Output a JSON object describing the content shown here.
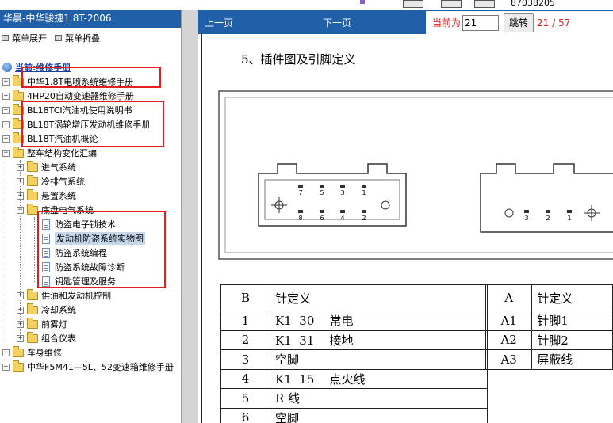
{
  "top_strip": {
    "phone_fragment": "87038205"
  },
  "left_panel": {
    "title": "华晨-中华骏捷1.8T-2006",
    "menu_expand": "菜单展开",
    "menu_collapse": "菜单折叠",
    "root_label": "当前:维修手册",
    "tree": [
      {
        "label": "中华1.8T电喷系统维修手册",
        "pm": "+"
      },
      {
        "label": "4HP20自动变速器维修手册",
        "pm": "+"
      },
      {
        "label": "BL18TCI汽油机使用说明书",
        "pm": "+"
      },
      {
        "label": "BL18T涡轮增压发动机维修手册",
        "pm": "+"
      },
      {
        "label": "BL18T汽油机概论",
        "pm": "+"
      },
      {
        "label": "整车结构变化汇编",
        "pm": "−",
        "children": [
          {
            "label": "进气系统",
            "pm": "+"
          },
          {
            "label": "冷排气系统",
            "pm": "+"
          },
          {
            "label": "悬置系统",
            "pm": "+"
          },
          {
            "label": "底盘电气系统",
            "pm": "−",
            "children": [
              {
                "label": "防盗电子锁技术"
              },
              {
                "label": "发动机防盗系统实物图"
              },
              {
                "label": "防盗系统编程"
              },
              {
                "label": "防盗系统故障诊断"
              },
              {
                "label": "钥匙管理及服务"
              }
            ]
          },
          {
            "label": "供油和发动机控制",
            "pm": "+"
          },
          {
            "label": "冷却系统",
            "pm": "+"
          },
          {
            "label": "前雾灯",
            "pm": "+"
          },
          {
            "label": "组合仪表",
            "pm": "+"
          }
        ]
      },
      {
        "label": "车身维修",
        "pm": "+"
      },
      {
        "label": "中华F5M41—5L、52变速箱维修手册",
        "pm": "+"
      }
    ]
  },
  "viewer": {
    "prev_label": "上一页",
    "next_label": "下一页",
    "current_label": "当前为",
    "current_page": "21",
    "jump_label": "跳转",
    "page_count": "21 / 57"
  },
  "document": {
    "heading": "5、插件图及引脚定义",
    "connector_b_pins": [
      "7",
      "5",
      "3",
      "1",
      "8",
      "6",
      "4",
      "2"
    ],
    "connector_a_pins": [
      "3",
      "2",
      "1"
    ],
    "table_b": {
      "header": [
        "B",
        "针定义"
      ],
      "rows": [
        [
          "1",
          "K1  30    常电"
        ],
        [
          "2",
          "K1  31    接地"
        ],
        [
          "3",
          "空脚"
        ],
        [
          "4",
          "K1  15    点火线"
        ],
        [
          "5",
          "R 线"
        ],
        [
          "6",
          "空脚"
        ]
      ]
    },
    "table_a": {
      "header": [
        "A",
        "针定义"
      ],
      "rows": [
        [
          "A1",
          "针脚1"
        ],
        [
          "A2",
          "针脚2"
        ],
        [
          "A3",
          "屏蔽线"
        ]
      ]
    }
  }
}
